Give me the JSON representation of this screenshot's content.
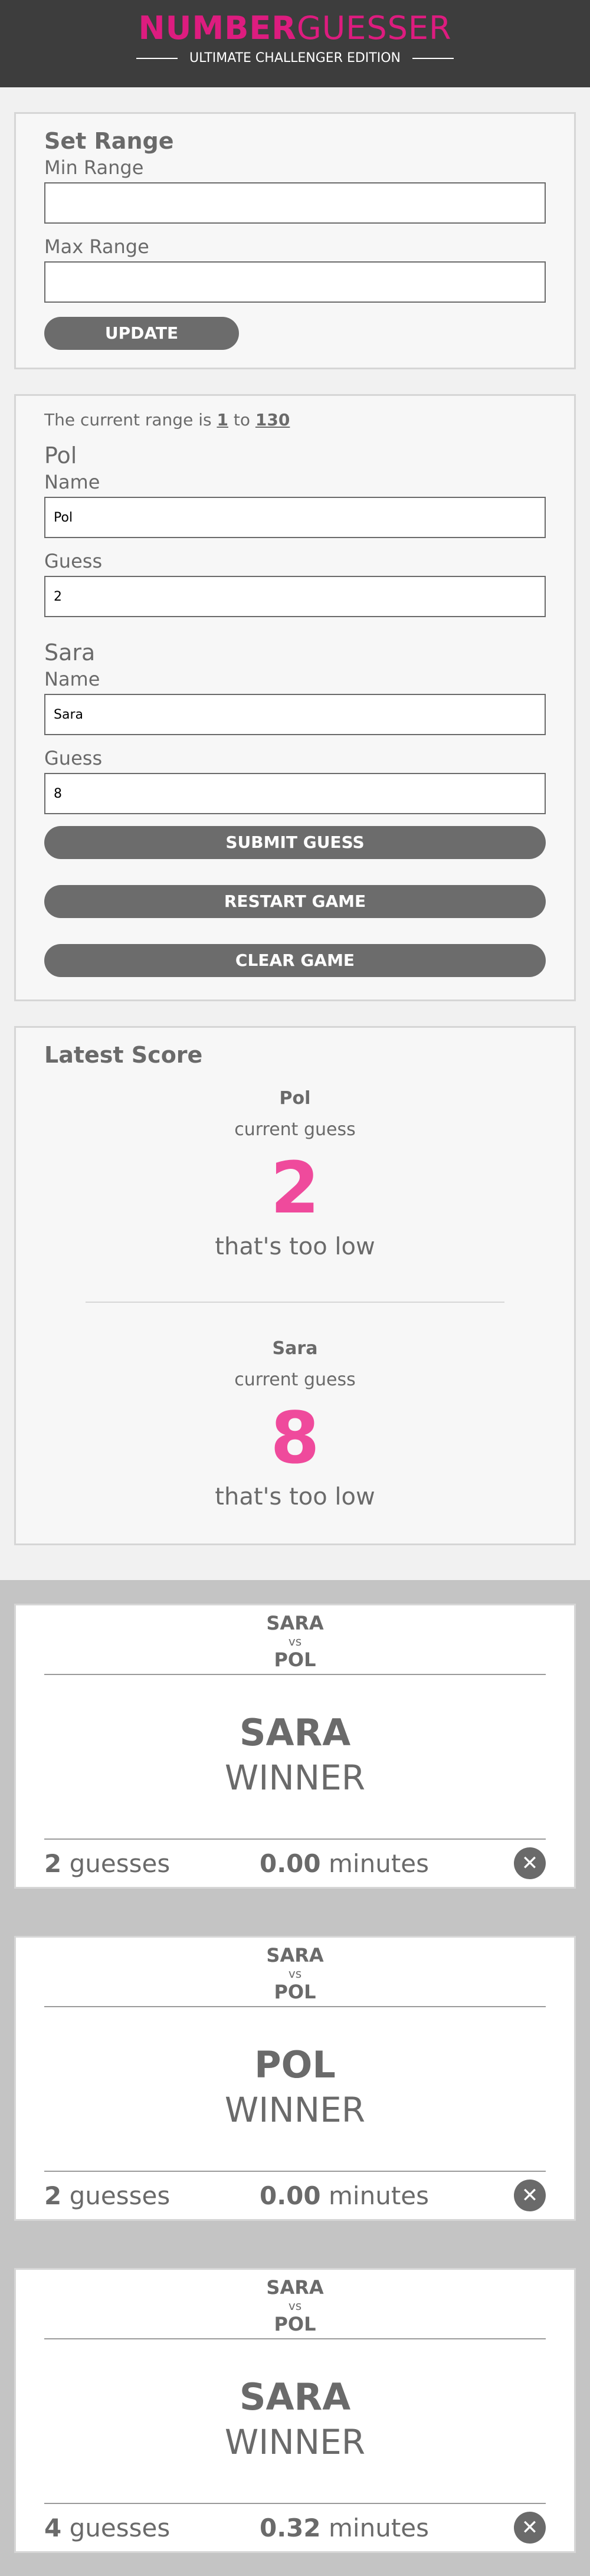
{
  "header": {
    "logo_part1": "NUMBER",
    "logo_part2": "GUESSER",
    "tagline": "ULTIMATE CHALLENGER EDITION"
  },
  "range_panel": {
    "title": "Set Range",
    "min_label": "Min Range",
    "min_value": "",
    "max_label": "Max Range",
    "max_value": "",
    "update_button": "UPDATE"
  },
  "guess_panel": {
    "range_prefix": "The current range is",
    "range_min": "1",
    "range_to": "to",
    "range_max": "130",
    "players": [
      {
        "heading": "Pol",
        "name_label": "Name",
        "name_value": "Pol",
        "guess_label": "Guess",
        "guess_value": "2"
      },
      {
        "heading": "Sara",
        "name_label": "Name",
        "name_value": "Sara",
        "guess_label": "Guess",
        "guess_value": "8"
      }
    ],
    "submit_button": "SUBMIT GUESS",
    "restart_button": "RESTART GAME",
    "clear_button": "CLEAR GAME"
  },
  "score_panel": {
    "title": "Latest Score",
    "entries": [
      {
        "name": "Pol",
        "label": "current guess",
        "guess": "2",
        "verdict": "that's too low"
      },
      {
        "name": "Sara",
        "label": "current guess",
        "guess": "8",
        "verdict": "that's too low"
      }
    ]
  },
  "cards": [
    {
      "player1": "SARA",
      "vs": "vs",
      "player2": "POL",
      "winner": "SARA",
      "winner_label": "WINNER",
      "guesses": "2",
      "guesses_label": "guesses",
      "minutes": "0.00",
      "minutes_label": "minutes",
      "close_icon": "close-icon"
    },
    {
      "player1": "SARA",
      "vs": "vs",
      "player2": "POL",
      "winner": "POL",
      "winner_label": "WINNER",
      "guesses": "2",
      "guesses_label": "guesses",
      "minutes": "0.00",
      "minutes_label": "minutes",
      "close_icon": "close-icon"
    },
    {
      "player1": "SARA",
      "vs": "vs",
      "player2": "POL",
      "winner": "SARA",
      "winner_label": "WINNER",
      "guesses": "4",
      "guesses_label": "guesses",
      "minutes": "0.32",
      "minutes_label": "minutes",
      "close_icon": "close-icon"
    }
  ],
  "colors": {
    "brand_pink": "#dd1c7f",
    "guess_pink": "#ef4a9c",
    "header_bg": "#3d3d3d",
    "button_gray": "#6c6c6c"
  }
}
